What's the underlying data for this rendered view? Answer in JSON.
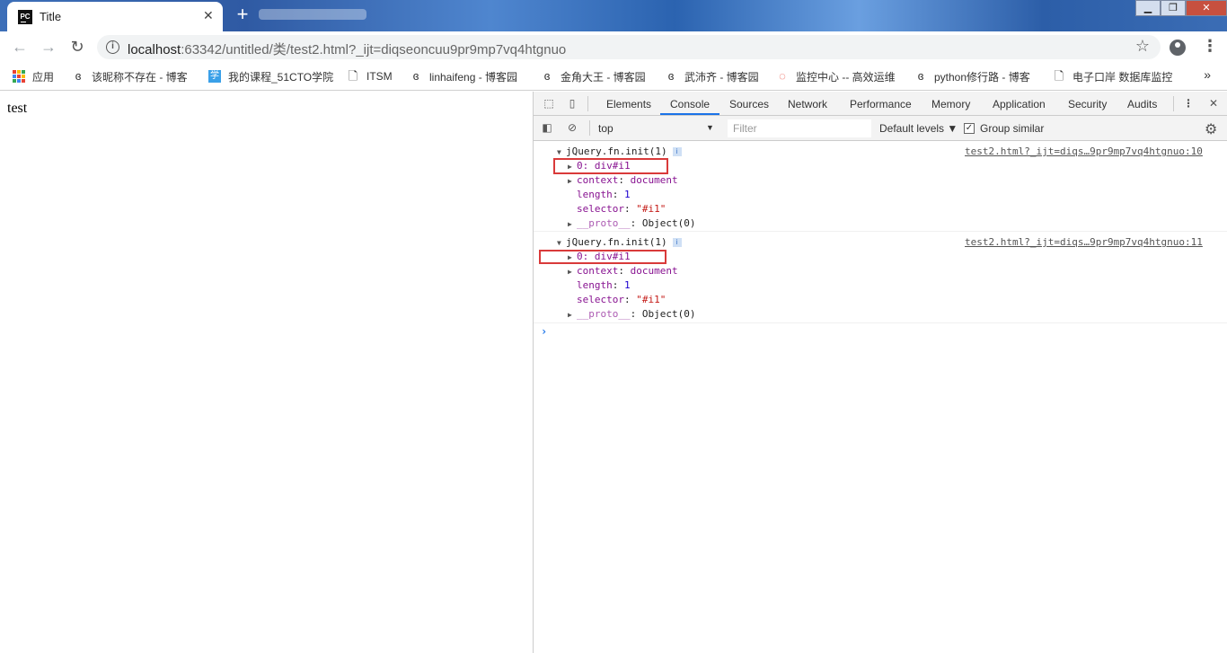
{
  "browser": {
    "tab_title": "Title",
    "tab_favicon": "PC",
    "url_host": "localhost",
    "url_rest": ":63342/untitled/类/test2.html?_ijt=diqseoncuu9pr9mp7vq4htgnuo"
  },
  "bookmarks": [
    {
      "label": "应用",
      "icon": "apps-grid-icon"
    },
    {
      "label": "该昵称不存在 - 博客",
      "icon": "cnblogs-icon"
    },
    {
      "label": "我的课程_51CTO学院",
      "icon": "51cto-icon"
    },
    {
      "label": "ITSM",
      "icon": "page-icon"
    },
    {
      "label": "linhaifeng - 博客园",
      "icon": "cnblogs-icon"
    },
    {
      "label": "金角大王 - 博客园",
      "icon": "cnblogs-icon"
    },
    {
      "label": "武沛齐 - 博客园",
      "icon": "cnblogs-icon"
    },
    {
      "label": "监控中心 -- 高效运维",
      "icon": "loading-icon"
    },
    {
      "label": "python修行路 - 博客",
      "icon": "cnblogs-icon"
    },
    {
      "label": "电子口岸 数据库监控",
      "icon": "page-icon"
    }
  ],
  "page": {
    "body_text": "test"
  },
  "devtools": {
    "tabs": [
      "Elements",
      "Console",
      "Sources",
      "Network",
      "Performance",
      "Memory",
      "Application",
      "Security",
      "Audits"
    ],
    "active_tab": "Console",
    "context": "top",
    "filter_placeholder": "Filter",
    "levels": "Default levels ▼",
    "group_similar": "Group similar",
    "messages": [
      {
        "header": "jQuery.fn.init(1)",
        "source": "test2.html?_ijt=diqs…9pr9mp7vq4htgnuo:10",
        "item0": "0: div#i1",
        "context_key": "context",
        "context_val": "document",
        "length_key": "length",
        "length_val": "1",
        "selector_key": "selector",
        "selector_val": "\"#i1\"",
        "proto_key": "__proto__",
        "proto_val": "Object(0)"
      },
      {
        "header": "jQuery.fn.init(1)",
        "source": "test2.html?_ijt=diqs…9pr9mp7vq4htgnuo:11",
        "item0": "0: div#i1",
        "context_key": "context",
        "context_val": "document",
        "length_key": "length",
        "length_val": "1",
        "selector_key": "selector",
        "selector_val": "\"#i1\"",
        "proto_key": "__proto__",
        "proto_val": "Object(0)"
      }
    ]
  },
  "colors": {
    "highlight_box": "#d93a3a",
    "active_tab_underline": "#1a73e8"
  }
}
